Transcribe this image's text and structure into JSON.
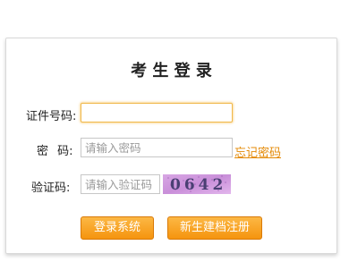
{
  "login": {
    "title": "考 生 登 录",
    "id_label": "证件号码:",
    "id_value": "",
    "password_label": "密  码:",
    "password_placeholder": "请输入密码",
    "forgot_password": "忘记密码",
    "captcha_label": "验证码:",
    "captcha_placeholder": "请输入验证码",
    "captcha_code": "0642",
    "login_button": "登录系统",
    "register_button": "新生建档注册"
  },
  "colors": {
    "accent": "#f7a21b",
    "link": "#e48a06",
    "focus_border": "#f0b84a"
  }
}
